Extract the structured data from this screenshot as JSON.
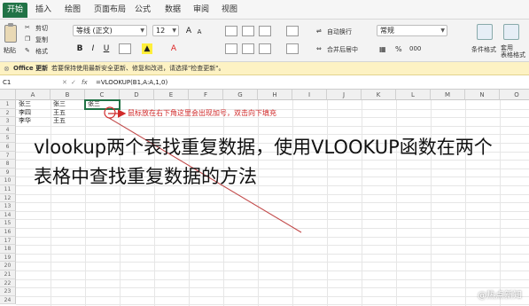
{
  "menu_tabs": [
    "开始",
    "插入",
    "绘图",
    "页面布局",
    "公式",
    "数据",
    "审阅",
    "视图"
  ],
  "ribbon": {
    "paste": "粘贴",
    "cut": "剪切",
    "copy": "复制",
    "format_painter": "格式",
    "font_name": "等线 (正文)",
    "font_size": "12",
    "bold": "B",
    "italic": "I",
    "underline": "U",
    "grow_font": "A",
    "shrink_font": "A",
    "wrap_text": "自动换行",
    "merge_center": "合并后居中",
    "number_format": "常规",
    "percent": "%",
    "comma": "000",
    "conditional_format": "条件格式",
    "table_format": "套用\n表格格式"
  },
  "notice": {
    "brand": "Office 更新",
    "text": "若要保持使用最新安全更新、修复和改进，请选择\"检查更新\"。"
  },
  "formula_bar": {
    "cell_ref": "C1",
    "fx": "fx",
    "formula": "=VLOOKUP(B1,A:A,1,0)"
  },
  "grid": {
    "columns": [
      "A",
      "B",
      "C",
      "D",
      "E",
      "F",
      "G",
      "H",
      "I",
      "J",
      "K",
      "L",
      "M",
      "N",
      "O"
    ],
    "rows": [
      "1",
      "2",
      "3",
      "4",
      "5",
      "6",
      "7",
      "8",
      "9",
      "10",
      "11",
      "12",
      "13",
      "14",
      "15",
      "16",
      "17",
      "18",
      "19",
      "20",
      "21",
      "22",
      "23",
      "24"
    ],
    "cells": {
      "A1": "张三",
      "B1": "张三",
      "C1": "张三",
      "A2": "李四",
      "B2": "王五",
      "A3": "李华",
      "B3": "王五"
    }
  },
  "annotation": "鼠标放在右下角这里会出现加号，双击向下填充",
  "overlay_title": "vlookup两个表找重复数据，使用VLOOKUP函数在两个表格中查找重复数据的方法",
  "watermark": "@热点新知",
  "colors": {
    "accent": "#217346",
    "annotation": "#d12a2a"
  }
}
